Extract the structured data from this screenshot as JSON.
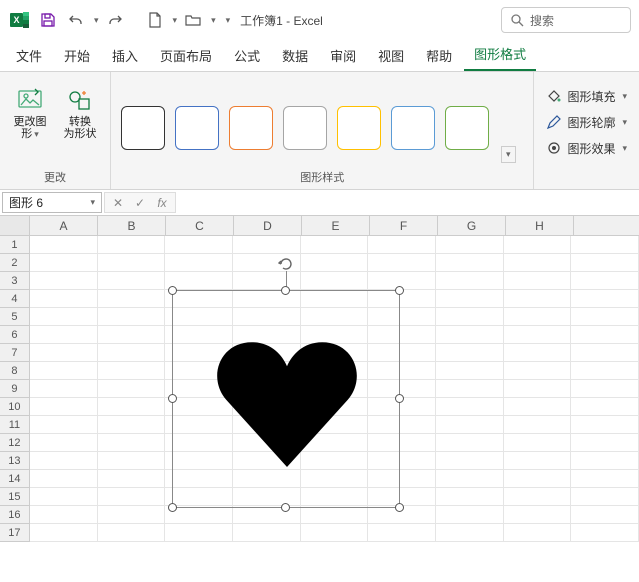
{
  "title": "工作簿1 - Excel",
  "search": {
    "placeholder": "搜索"
  },
  "tabs": [
    "文件",
    "开始",
    "插入",
    "页面布局",
    "公式",
    "数据",
    "审阅",
    "视图",
    "帮助",
    "图形格式"
  ],
  "activeTab": "图形格式",
  "ribbon": {
    "group1": {
      "label": "更改",
      "btn1_l1": "更改图",
      "btn1_l2": "形",
      "btn2_l1": "转换",
      "btn2_l2": "为形状"
    },
    "group2": {
      "label": "图形样式"
    },
    "group3": {
      "fill": "图形填充",
      "outline": "图形轮廓",
      "effects": "图形效果"
    },
    "styleColors": [
      "#333333",
      "#4472c4",
      "#ed7d31",
      "#a5a5a5",
      "#ffc000",
      "#5b9bd5",
      "#70ad47"
    ]
  },
  "namebox": "图形 6",
  "columns": [
    "A",
    "B",
    "C",
    "D",
    "E",
    "F",
    "G",
    "H"
  ],
  "rowCount": 17,
  "shape": {
    "name": "heart",
    "fill": "#000000"
  }
}
